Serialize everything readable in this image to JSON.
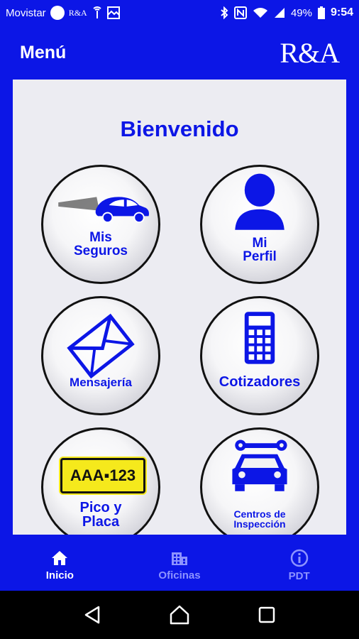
{
  "status_bar": {
    "carrier": "Movistar",
    "app_badge": "R&A",
    "battery": "49%",
    "time": "9:54"
  },
  "app_bar": {
    "title": "Menú",
    "logo_text": "R&A"
  },
  "main": {
    "welcome": "Bienvenido",
    "tiles": [
      {
        "line1": "Mis",
        "line2": "Seguros",
        "icon": "car-icon"
      },
      {
        "line1": "Mi",
        "line2": "Perfil",
        "icon": "person-icon"
      },
      {
        "line1": "Mensajería",
        "line2": "",
        "icon": "envelope-icon"
      },
      {
        "line1": "Cotizadores",
        "line2": "",
        "icon": "calculator-icon"
      },
      {
        "line1": "Pico y",
        "line2": "Placa",
        "plate": "AAA▪123",
        "icon": "license-plate-icon"
      },
      {
        "line1": "Centros de",
        "line2": "Inspección",
        "icon": "car-repair-icon"
      }
    ]
  },
  "bottom_nav": {
    "items": [
      {
        "label": "Inicio",
        "icon": "home-icon",
        "active": true
      },
      {
        "label": "Oficinas",
        "icon": "building-icon",
        "active": false
      },
      {
        "label": "PDT",
        "icon": "info-icon",
        "active": false
      }
    ]
  },
  "colors": {
    "primary": "#0c16e6",
    "background": "#ececf2",
    "plate": "#f5e91c"
  }
}
